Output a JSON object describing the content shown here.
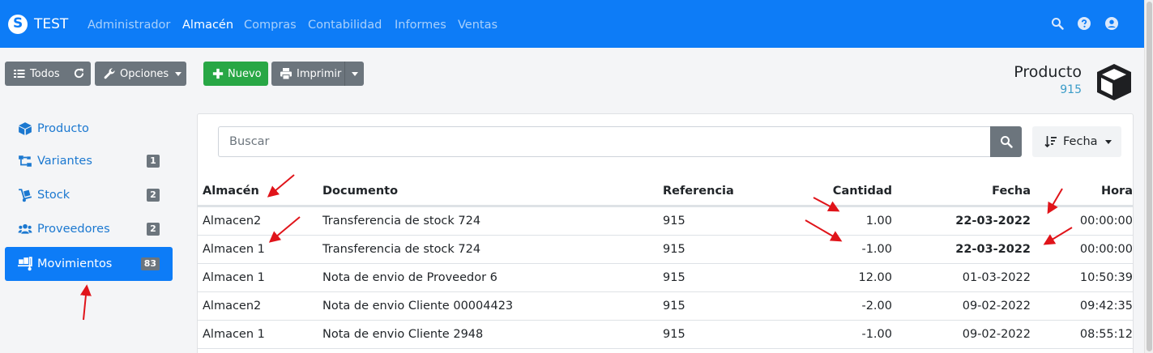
{
  "navbar": {
    "brand": "TEST",
    "items": [
      {
        "label": "Administrador",
        "active": false
      },
      {
        "label": "Almacén",
        "active": true
      },
      {
        "label": "Compras",
        "active": false
      },
      {
        "label": "Contabilidad",
        "active": false
      },
      {
        "label": "Informes",
        "active": false
      },
      {
        "label": "Ventas",
        "active": false
      }
    ],
    "right_icons": [
      "search-icon",
      "help-icon",
      "user-icon"
    ]
  },
  "toolbar": {
    "all_label": "Todos",
    "options_label": "Opciones",
    "new_label": "Nuevo",
    "print_label": "Imprimir"
  },
  "product": {
    "title": "Producto",
    "number": "915"
  },
  "sidebar": {
    "items": [
      {
        "label": "Producto",
        "icon": "cube-icon",
        "badge": null,
        "active": false
      },
      {
        "label": "Variantes",
        "icon": "sitemap-icon",
        "badge": "1",
        "active": false
      },
      {
        "label": "Stock",
        "icon": "dolly-icon",
        "badge": "2",
        "active": false
      },
      {
        "label": "Proveedores",
        "icon": "users-icon",
        "badge": "2",
        "active": false
      },
      {
        "label": "Movimientos",
        "icon": "truck-loading-icon",
        "badge": "83",
        "active": true
      }
    ]
  },
  "search": {
    "placeholder": "Buscar",
    "sort_label": "Fecha"
  },
  "table": {
    "columns": [
      "Almacén",
      "Documento",
      "Referencia",
      "Cantidad",
      "Fecha",
      "Hora"
    ],
    "rows": [
      {
        "almacen": "Almacen2",
        "documento": "Transferencia de stock 724",
        "referencia": "915",
        "cantidad": "1.00",
        "fecha": "22-03-2022",
        "hora": "00:00:00",
        "fecha_bold": true
      },
      {
        "almacen": "Almacen 1",
        "documento": "Transferencia de stock 724",
        "referencia": "915",
        "cantidad": "-1.00",
        "fecha": "22-03-2022",
        "hora": "00:00:00",
        "fecha_bold": true
      },
      {
        "almacen": "Almacen 1",
        "documento": "Nota de envio de Proveedor 6",
        "referencia": "915",
        "cantidad": "12.00",
        "fecha": "01-03-2022",
        "hora": "10:50:39",
        "fecha_bold": false
      },
      {
        "almacen": "Almacen2",
        "documento": "Nota de envio Cliente 00004423",
        "referencia": "915",
        "cantidad": "-2.00",
        "fecha": "09-02-2022",
        "hora": "09:42:35",
        "fecha_bold": false
      },
      {
        "almacen": "Almacen 1",
        "documento": "Nota de envio Cliente 2948",
        "referencia": "915",
        "cantidad": "-1.00",
        "fecha": "09-02-2022",
        "hora": "08:55:12",
        "fecha_bold": false
      }
    ]
  },
  "colors": {
    "navbar": "#0d7cf7",
    "link": "#1b78d0",
    "button_gray": "#6c757d",
    "button_green": "#28a745",
    "annotation_arrow": "#e0141a"
  }
}
